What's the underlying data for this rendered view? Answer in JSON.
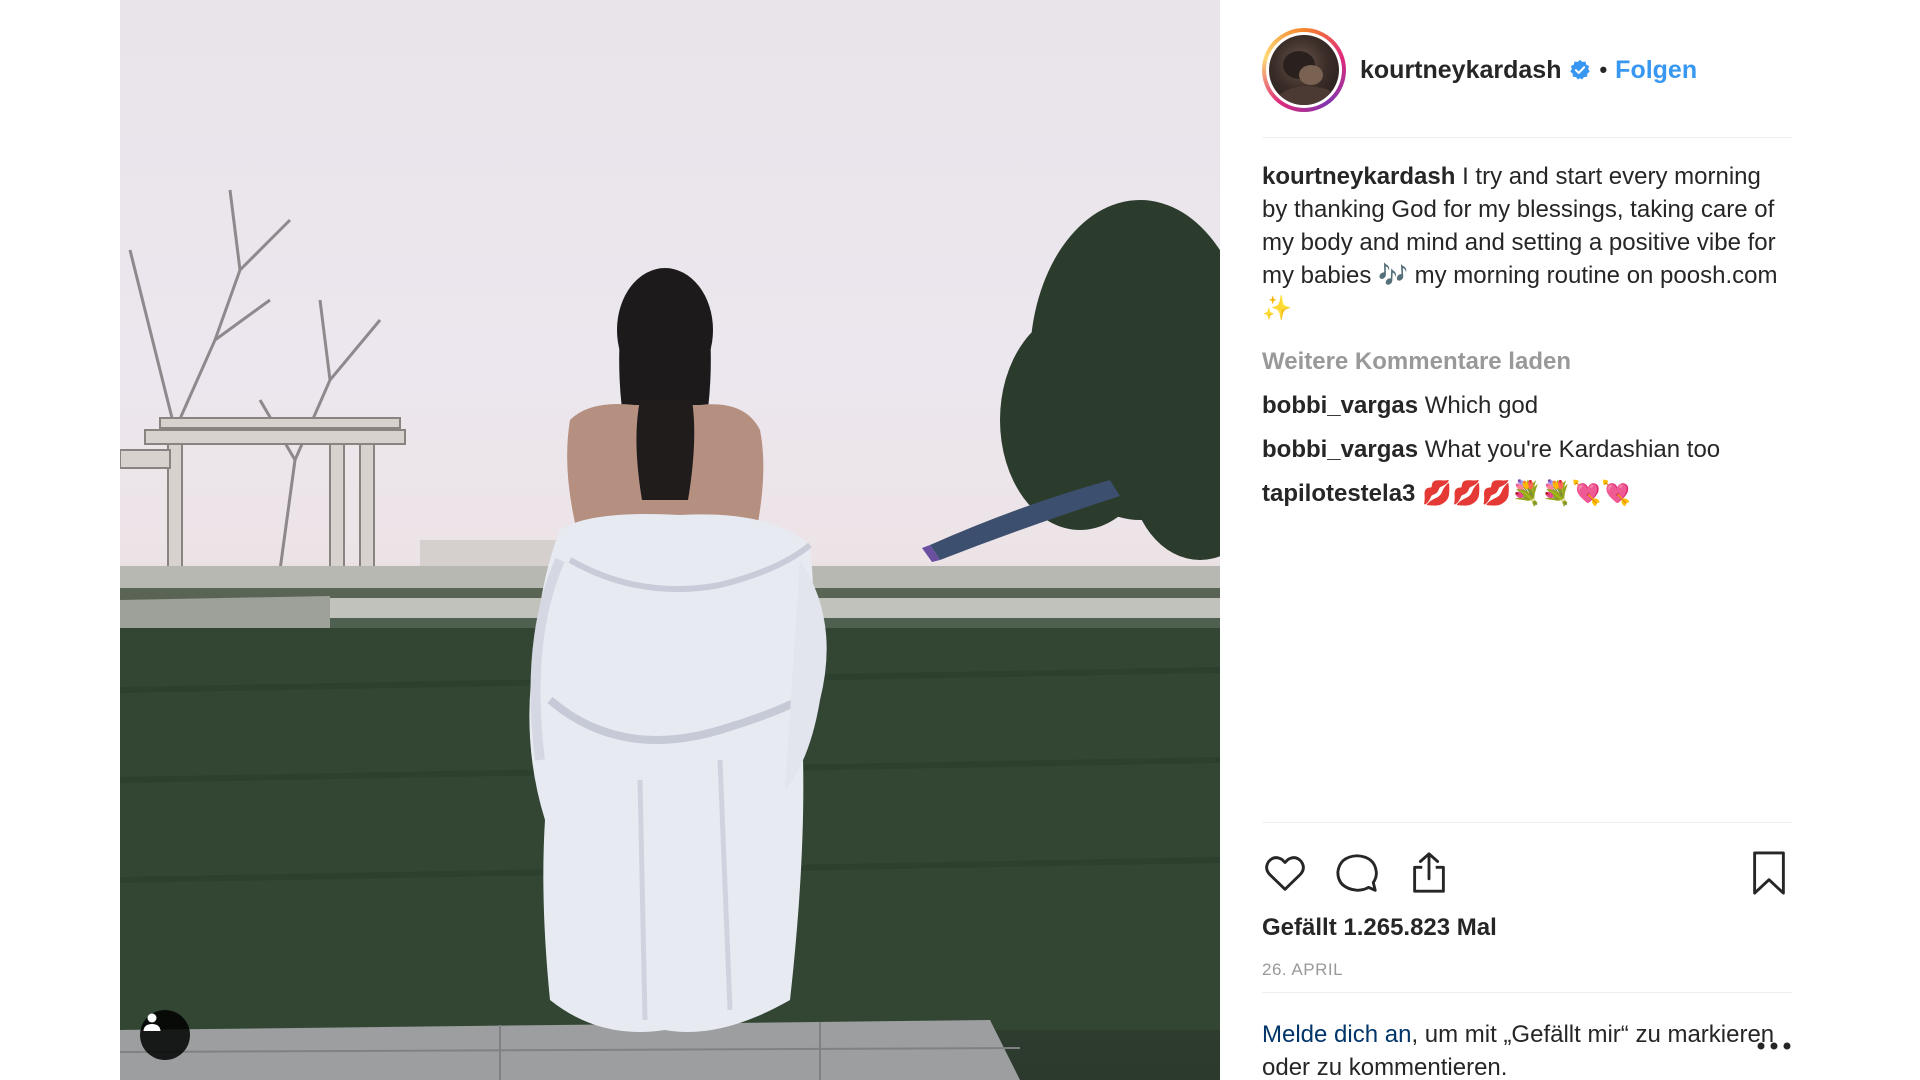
{
  "post": {
    "username": "kourtneykardash",
    "follow_label": "Folgen",
    "separator": "•",
    "caption_user": "kourtneykardash",
    "caption_text": " I try and start every morning by thanking God for my blessings, taking care of my body and mind and setting a positive vibe for my babies 🎶 my morning routine on poosh.com ✨",
    "load_more_label": "Weitere Kommentare laden",
    "comments": [
      {
        "user": "bobbi_vargas",
        "text": " Which god"
      },
      {
        "user": "bobbi_vargas",
        "text": " What you're Kardashian too"
      },
      {
        "user": "tapilotestela3",
        "text": " 💋💋💋💐💐💘💘"
      }
    ],
    "likes_label": "Gefällt 1.265.823 Mal",
    "date_label": "26. APRIL",
    "login_link": "Melde dich an",
    "login_rest": ", um mit „Gefällt mir“ zu markieren oder zu kommentieren."
  },
  "icons": {
    "verified": "verified-badge-icon",
    "like": "heart-icon",
    "comment": "comment-bubble-icon",
    "share": "share-icon",
    "save": "bookmark-icon",
    "more": "more-dots-icon",
    "user_tag": "user-tag-icon"
  },
  "colors": {
    "accent": "#3897f0",
    "link": "#003569",
    "muted": "#999999",
    "text": "#262626"
  }
}
